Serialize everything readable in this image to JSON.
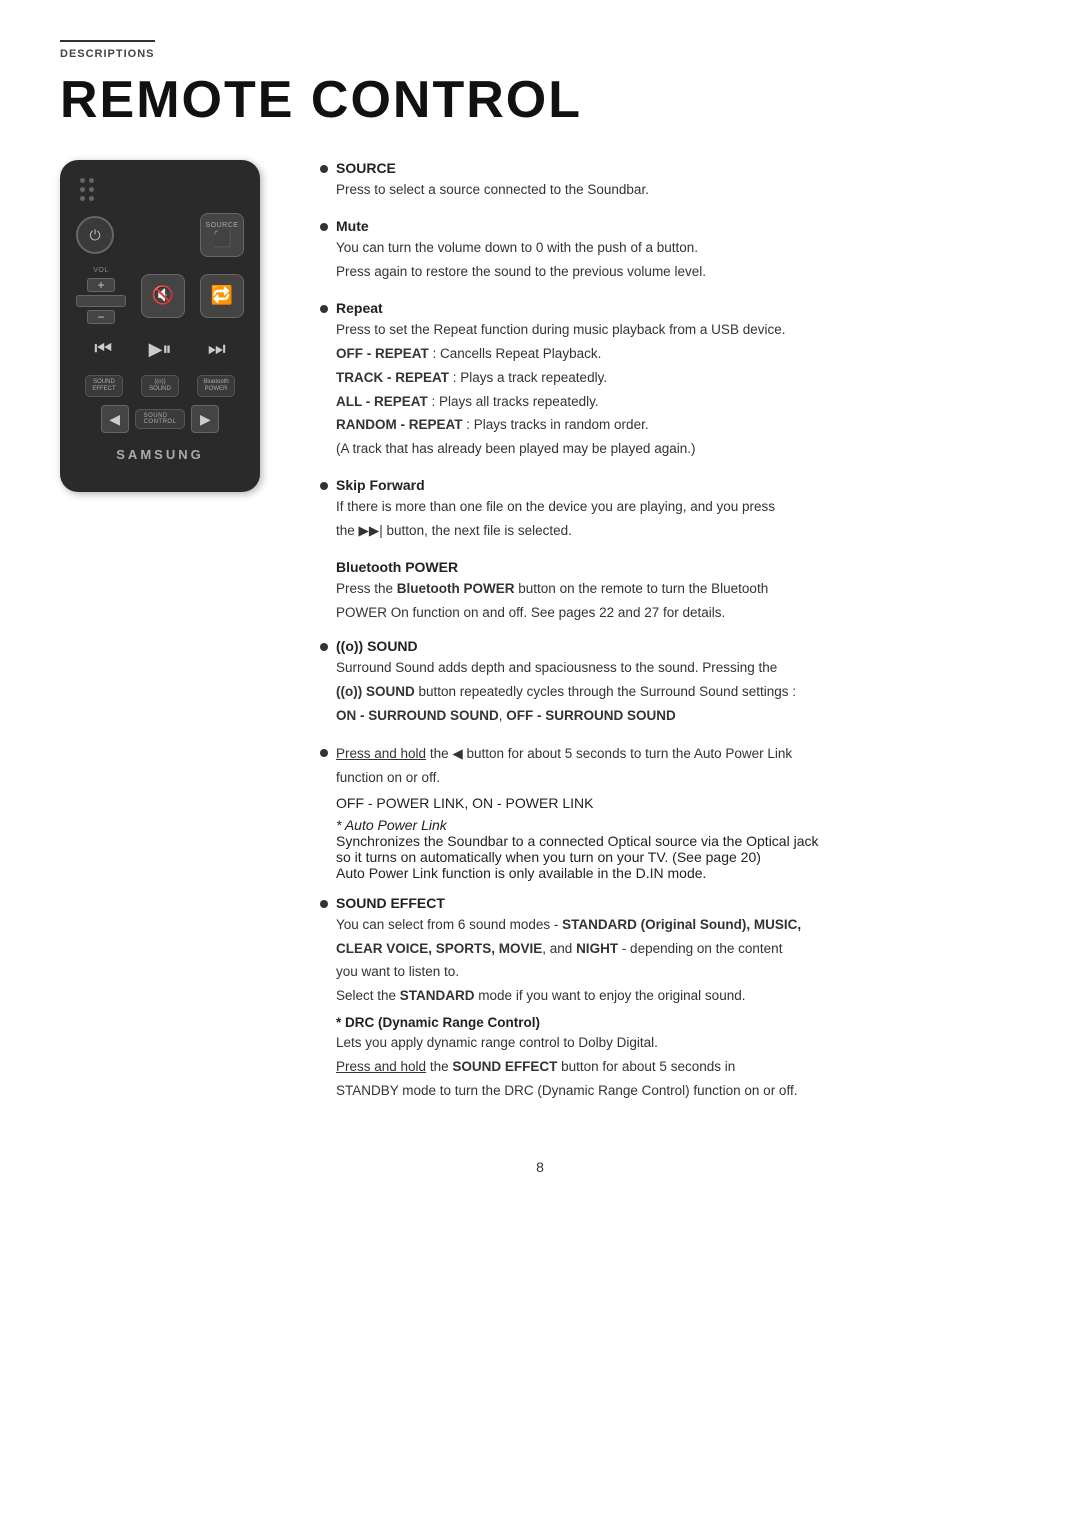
{
  "page": {
    "section_label": "DESCRIPTIONS",
    "title": "REMOTE CONTROL",
    "page_number": "8"
  },
  "remote": {
    "source_label": "SOURCE",
    "samsung_logo": "SAMSUNG",
    "sound_effect_label": "SOUND\nEFFECT",
    "sound_label": "SOUND",
    "bluetooth_label": "Bluetooth\nPOWER",
    "sound_control_label": "SOUND\nCONTROL",
    "vol_label": "VOL"
  },
  "descriptions": [
    {
      "id": "source",
      "title": "SOURCE",
      "has_bullet": true,
      "body": "Press to select a source connected to the Soundbar."
    },
    {
      "id": "mute",
      "title": "Mute",
      "has_bullet": true,
      "body_lines": [
        "You can turn the volume down to 0 with the push of a button.",
        "Press again to restore the sound to the previous volume level."
      ]
    },
    {
      "id": "repeat",
      "title": "Repeat",
      "has_bullet": true,
      "body_lines": [
        "Press to set the Repeat function during music playback from a USB device."
      ],
      "sub_items": [
        {
          "label": "OFF - REPEAT",
          "text": ": Cancells Repeat Playback."
        },
        {
          "label": "TRACK - REPEAT",
          "text": ": Plays a track repeatedly."
        },
        {
          "label": "ALL - REPEAT",
          "text": ": Plays all tracks repeatedly."
        },
        {
          "label": "RANDOM - REPEAT",
          "text": ": Plays tracks in random order."
        }
      ],
      "note": "(A track that has already been played may be played again.)"
    },
    {
      "id": "skip-forward",
      "title": "Skip Forward",
      "has_bullet": true,
      "body_lines": [
        "If there is more than one file on the device you are playing, and you press",
        "the ▶▶| button, the next file is selected."
      ]
    },
    {
      "id": "bluetooth-power",
      "title": "Bluetooth POWER",
      "has_bullet": false,
      "body_lines": [
        "Press the Bluetooth POWER button on the remote to turn the Bluetooth",
        "POWER On function on and off. See pages 22 and 27 for details."
      ]
    },
    {
      "id": "sound",
      "title": "((o)) SOUND",
      "has_bullet": true,
      "body_lines": [
        "Surround Sound adds depth and spaciousness to the sound. Pressing the",
        "((o)) SOUND button repeatedly cycles through the Surround Sound settings :"
      ],
      "emphasis": "ON - SURROUND SOUND, OFF - SURROUND SOUND"
    },
    {
      "id": "sound-control",
      "title": "",
      "has_bullet": true,
      "body_lines": [
        "Press and hold the ◀ button for about 5 seconds to turn the Auto Power Link",
        "function on or off."
      ],
      "power_link": "OFF - POWER LINK, ON - POWER LINK",
      "auto_power_note": "* Auto Power Link",
      "auto_power_lines": [
        "Synchronizes the Soundbar to a connected Optical source via the Optical jack",
        "so it turns on automatically when you turn on your TV. (See page 20)",
        "Auto Power Link function is only available in the D.IN mode."
      ]
    },
    {
      "id": "sound-effect",
      "title": "SOUND EFFECT",
      "has_bullet": true,
      "body_lines": [
        "You can select from 6 sound modes - STANDARD (Original Sound), MUSIC,",
        "CLEAR VOICE, SPORTS, MOVIE, and NIGHT - depending on the content",
        "you want to listen to.",
        "Select the STANDARD mode if you want to enjoy the original sound."
      ],
      "drc": {
        "title": "* DRC (Dynamic Range Control)",
        "lines": [
          "Lets you apply dynamic range control to Dolby Digital.",
          "Press and hold the SOUND EFFECT button for about 5 seconds in",
          "STANDBY mode to turn the DRC (Dynamic Range Control) function on or off."
        ]
      }
    }
  ]
}
